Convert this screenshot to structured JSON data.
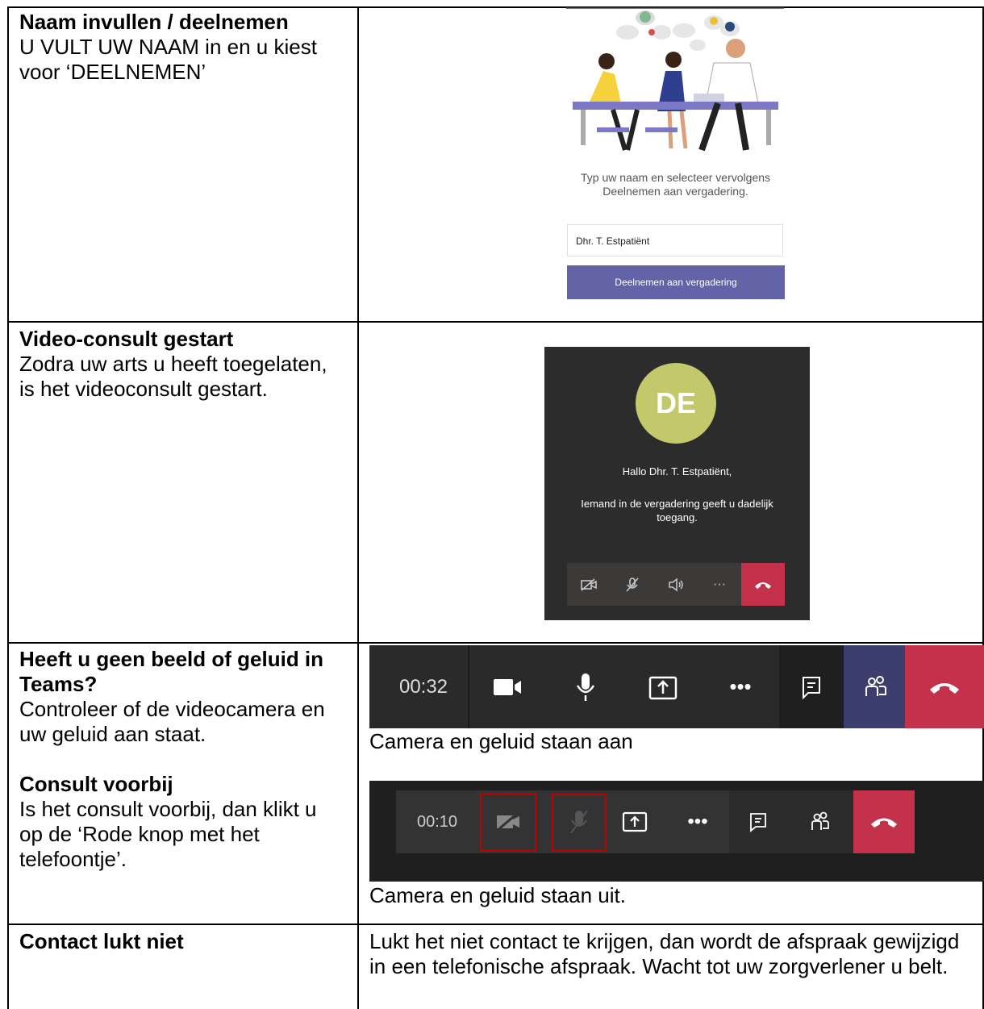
{
  "rows": [
    {
      "heading": "Naam invullen / deelnemen",
      "body": "U VULT UW NAAM in en u kiest voor ‘DEELNEMEN’"
    },
    {
      "heading": "Video-consult gestart",
      "body": "Zodra uw arts u heeft toegelaten, is het videoconsult gestart."
    },
    {
      "heading": "Heeft u geen beeld of geluid in Teams?",
      "body": "Controleer of de videocamera en uw geluid aan staat.",
      "heading2": "Consult voorbij",
      "body2": "Is het consult voorbij, dan klikt u op de ‘Rode knop met het telefoontje’."
    },
    {
      "heading": "Contact lukt niet",
      "right_text": "Lukt het niet contact te krijgen, dan wordt de afspraak gewijzigd in een telefonische afspraak. Wacht tot uw zorgverlener u belt."
    }
  ],
  "join_screen": {
    "prompt": "Typ uw naam en selecteer vervolgens Deelnemen aan vergadering.",
    "name_value": "Dhr. T. Estpatiënt",
    "button_label": "Deelnemen aan vergadering"
  },
  "lobby": {
    "avatar_initials": "DE",
    "hello": "Hallo Dhr. T. Estpatiënt,",
    "message": "Iemand in de vergadering geeft u dadelijk toegang.",
    "more_label": "···"
  },
  "callbar_on": {
    "timer": "00:32",
    "more_label": "•••",
    "caption": "Camera en geluid staan aan"
  },
  "callbar_off": {
    "timer": "00:10",
    "more_label": "•••",
    "caption": "Camera en geluid staan uit."
  },
  "colors": {
    "teams_purple": "#6264a7",
    "hangup_red": "#c4314b",
    "avatar": "#c3c96b",
    "highlight_box": "#c00000"
  }
}
